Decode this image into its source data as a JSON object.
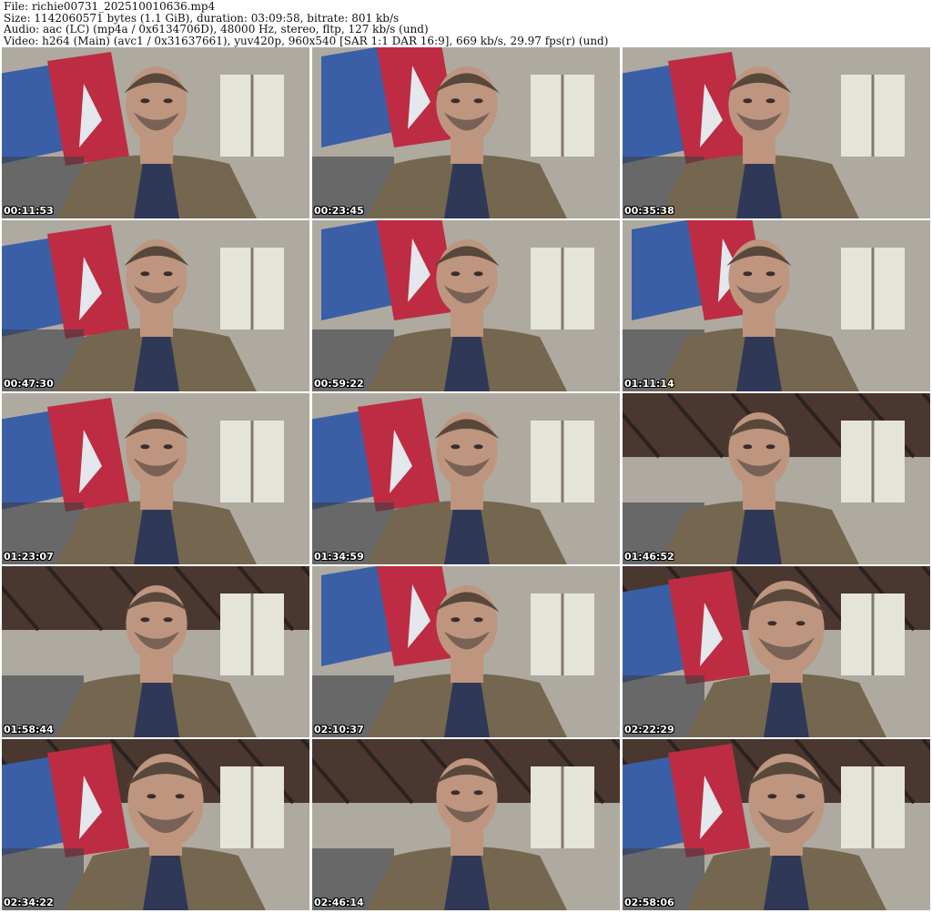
{
  "header": {
    "file_line": "File: richie00731_202510010636.mp4",
    "size_line": "Size: 1142060571 bytes (1.1 GiB), duration: 03:09:58, bitrate: 801 kb/s",
    "audio_line": "Audio: aac (LC) (mp4a / 0x6134706D), 48000 Hz, stereo, fltp, 127 kb/s (und)",
    "video_line": "Video: h264 (Main) (avc1 / 0x31637661), yuv420p, 960x540 [SAR 1:1 DAR 16:9], 669 kb/s, 29.97 fps(r) (und)"
  },
  "thumbnails": [
    {
      "timestamp": "00:11:53",
      "scene": "flag-left"
    },
    {
      "timestamp": "00:23:45",
      "scene": "flag-top"
    },
    {
      "timestamp": "00:35:38",
      "scene": "flag-left"
    },
    {
      "timestamp": "00:47:30",
      "scene": "flag-left"
    },
    {
      "timestamp": "00:59:22",
      "scene": "flag-top"
    },
    {
      "timestamp": "01:11:14",
      "scene": "flag-top"
    },
    {
      "timestamp": "01:23:07",
      "scene": "flag-left"
    },
    {
      "timestamp": "01:34:59",
      "scene": "flag-left"
    },
    {
      "timestamp": "01:46:52",
      "scene": "rafters"
    },
    {
      "timestamp": "01:58:44",
      "scene": "room-wide"
    },
    {
      "timestamp": "02:10:37",
      "scene": "flag-top"
    },
    {
      "timestamp": "02:22:29",
      "scene": "closeup"
    },
    {
      "timestamp": "02:34:22",
      "scene": "closeup"
    },
    {
      "timestamp": "02:46:14",
      "scene": "rafters"
    },
    {
      "timestamp": "02:58:06",
      "scene": "closeup"
    }
  ],
  "colors": {
    "flag_red": "#c8283a",
    "flag_blue": "#3a5fa8",
    "jacket": "#7a6648",
    "skin": "#c99a7c",
    "hair": "#5a4632",
    "wall": "#b8b0a0",
    "ceiling": "#4a3426"
  }
}
